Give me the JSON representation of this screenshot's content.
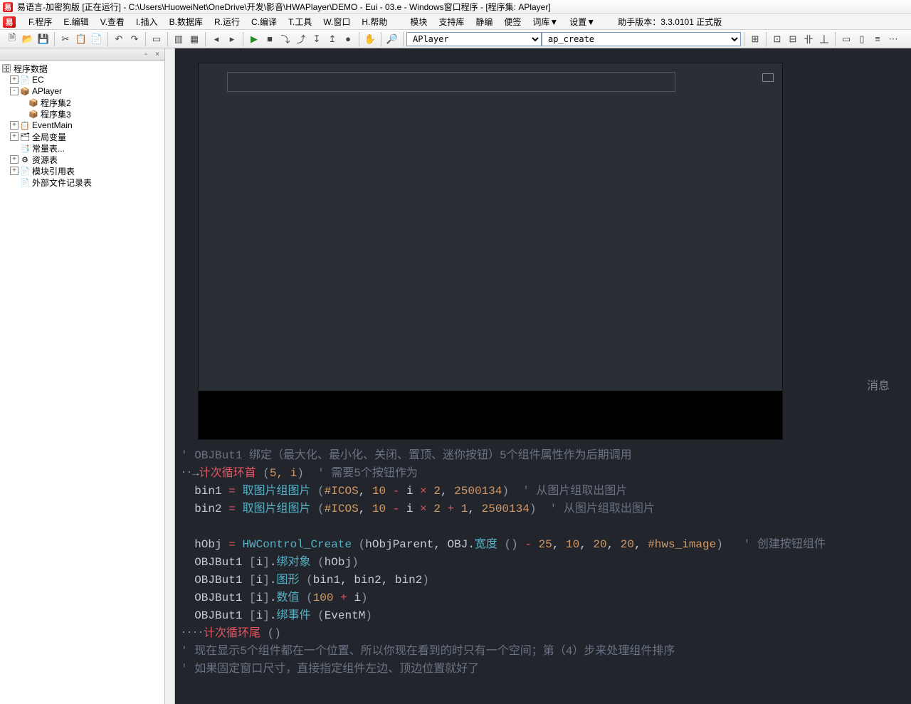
{
  "titlebar": {
    "text": "易语言-加密狗版 [正在运行] - C:\\Users\\HuoweiNet\\OneDrive\\开发\\影音\\HWAPlayer\\DEMO - Eui - 03.e - Windows窗口程序 - [程序集: APlayer]"
  },
  "menu": {
    "items": [
      "F.程序",
      "E.编辑",
      "V.查看",
      "I.插入",
      "B.数据库",
      "R.运行",
      "C.编译",
      "T.工具",
      "W.窗口",
      "H.帮助"
    ],
    "extra": [
      "模块",
      "支持库",
      "静编",
      "便签",
      "词库▼",
      "设置▼"
    ],
    "version": "助手版本：3.3.0101 正式版"
  },
  "toolbar": {
    "combo1": "APlayer",
    "combo2": "ap_create"
  },
  "tree": {
    "root": "程序数据",
    "nodes": [
      {
        "toggle": "+",
        "indent": 0,
        "icon": "📄",
        "label": "EC"
      },
      {
        "toggle": "-",
        "indent": 0,
        "icon": "📦",
        "label": "APlayer"
      },
      {
        "toggle": "",
        "indent": 1,
        "icon": "📦",
        "label": "程序集2"
      },
      {
        "toggle": "",
        "indent": 1,
        "icon": "📦",
        "label": "程序集3"
      },
      {
        "toggle": "+",
        "indent": 0,
        "icon": "📋",
        "label": "EventMain"
      },
      {
        "toggle": "+",
        "indent": 0,
        "icon": "🗂",
        "label": "全局变量"
      },
      {
        "toggle": "",
        "indent": 0,
        "icon": "📑",
        "label": "常量表..."
      },
      {
        "toggle": "+",
        "indent": 0,
        "icon": "⚙",
        "label": "资源表"
      },
      {
        "toggle": "+",
        "indent": 0,
        "icon": "📄",
        "label": "模块引用表"
      },
      {
        "toggle": "",
        "indent": 0,
        "icon": "📄",
        "label": "外部文件记录表"
      }
    ]
  },
  "player": {
    "msg": "消息"
  },
  "code": {
    "l1_comment": "' OBJBut1 绑定（最大化、最小化、关闭、置顶、迷你按钮）5个组件属性作为后期调用",
    "l2_key": "计次循环首",
    "l2_args": "5, i",
    "l2_comment": "' 需要5个按钮作为",
    "l3_var": "bin1",
    "l3_fn": "取图片组图片",
    "l3_a1": "#ICOS",
    "l3_a2": "10",
    "l3_a3": "i",
    "l3_a4": "2",
    "l3_a5": "2500134",
    "l3_comment": "' 从图片组取出图片",
    "l4_var": "bin2",
    "l4_fn": "取图片组图片",
    "l4_a1": "#ICOS",
    "l4_a2": "10",
    "l4_a3": "i",
    "l4_a4": "2",
    "l4_a5": "1",
    "l4_a6": "2500134",
    "l4_comment": "' 从图片组取出图片",
    "l6_var": "hObj",
    "l6_fn": "HWControl_Create",
    "l6_args_a": "hObjParent, OBJ",
    "l6_member": "宽度",
    "l6_n1": "25",
    "l6_n2": "10",
    "l6_n3": "20",
    "l6_n4": "20",
    "l6_const": "#hws_image",
    "l6_comment": "' 创建按钮组件",
    "l7_obj": "OBJBut1",
    "l7_idx": "i",
    "l7_member": "绑对象",
    "l7_arg": "hObj",
    "l8_obj": "OBJBut1",
    "l8_idx": "i",
    "l8_member": "图形",
    "l8_args": "bin1, bin2, bin2",
    "l9_obj": "OBJBut1",
    "l9_idx": "i",
    "l9_member": "数值",
    "l9_n1": "100",
    "l9_n2": "i",
    "l10_obj": "OBJBut1",
    "l10_idx": "i",
    "l10_member": "绑事件",
    "l10_arg": "EventM",
    "l11_key": "计次循环尾",
    "l12_comment": "' 现在显示5个组件都在一个位置、所以你现在看到的时只有一个空间；第（4）步来处理组件排序",
    "l13_comment": "' 如果固定窗口尺寸，直接指定组件左边、顶边位置就好了"
  }
}
